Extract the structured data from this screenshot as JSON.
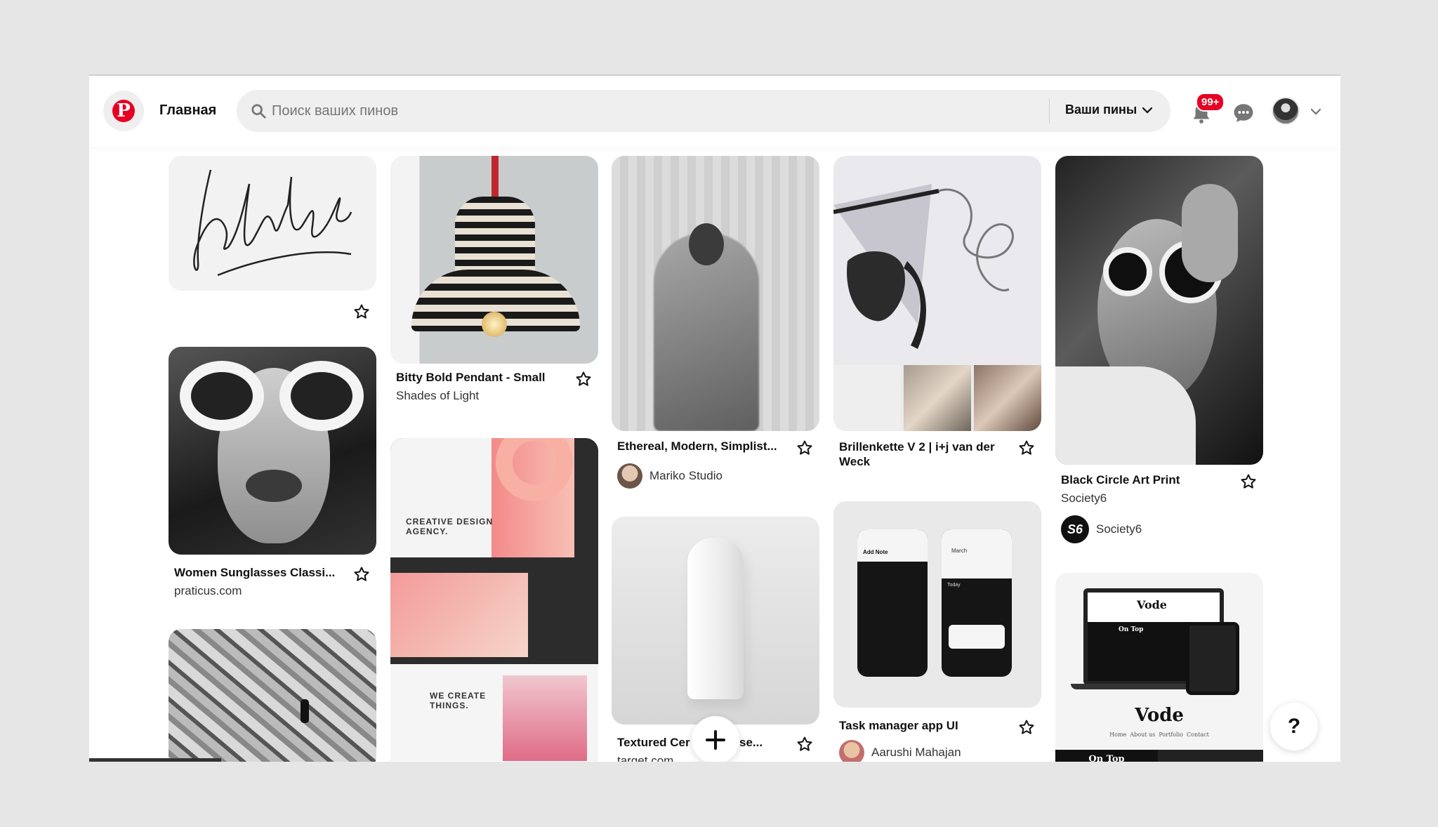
{
  "header": {
    "logo_icon": "pinterest-logo-icon",
    "logo_glyph": "P",
    "home_label": "Главная",
    "search_placeholder": "Поиск ваших пинов",
    "search_value": "",
    "filter_label": "Ваши пины",
    "notifications_badge": "99+",
    "accent_color": "#e60023"
  },
  "pins": [
    {
      "id": "signature",
      "title": "",
      "source": "",
      "icon": "star-icon"
    },
    {
      "id": "pendant",
      "title": "Bitty Bold Pendant - Small",
      "source": "Shades of Light"
    },
    {
      "id": "ethereal",
      "title": "Ethereal, Modern, Simplist...",
      "creator": "Mariko Studio"
    },
    {
      "id": "brillen",
      "title": "Brillenkette V 2 | i+j van der Weck"
    },
    {
      "id": "circle",
      "title": "Black Circle Art Print",
      "source": "Society6",
      "creator": "Society6",
      "creator_logo": "S6"
    },
    {
      "id": "sunglasses",
      "title": "Women Sunglasses Classi...",
      "source": "praticus.com"
    },
    {
      "id": "agency",
      "lines": [
        "CREATIVE DESIGN AGENCY.",
        "WE CREATE THINGS."
      ]
    },
    {
      "id": "vase",
      "title": "Textured Cer",
      "title_tail": "se...",
      "source": "target.com"
    },
    {
      "id": "task",
      "title": "Task manager app UI",
      "creator": "Aarushi Mahajan",
      "screen_labels": [
        "Add Note",
        "March",
        "Today"
      ]
    },
    {
      "id": "vode",
      "brand": "Vode",
      "badge": "On Top",
      "nav": "Home  About us  Portfolio  Contact"
    }
  ],
  "fab": {
    "plus_label": "+",
    "help_label": "?"
  }
}
